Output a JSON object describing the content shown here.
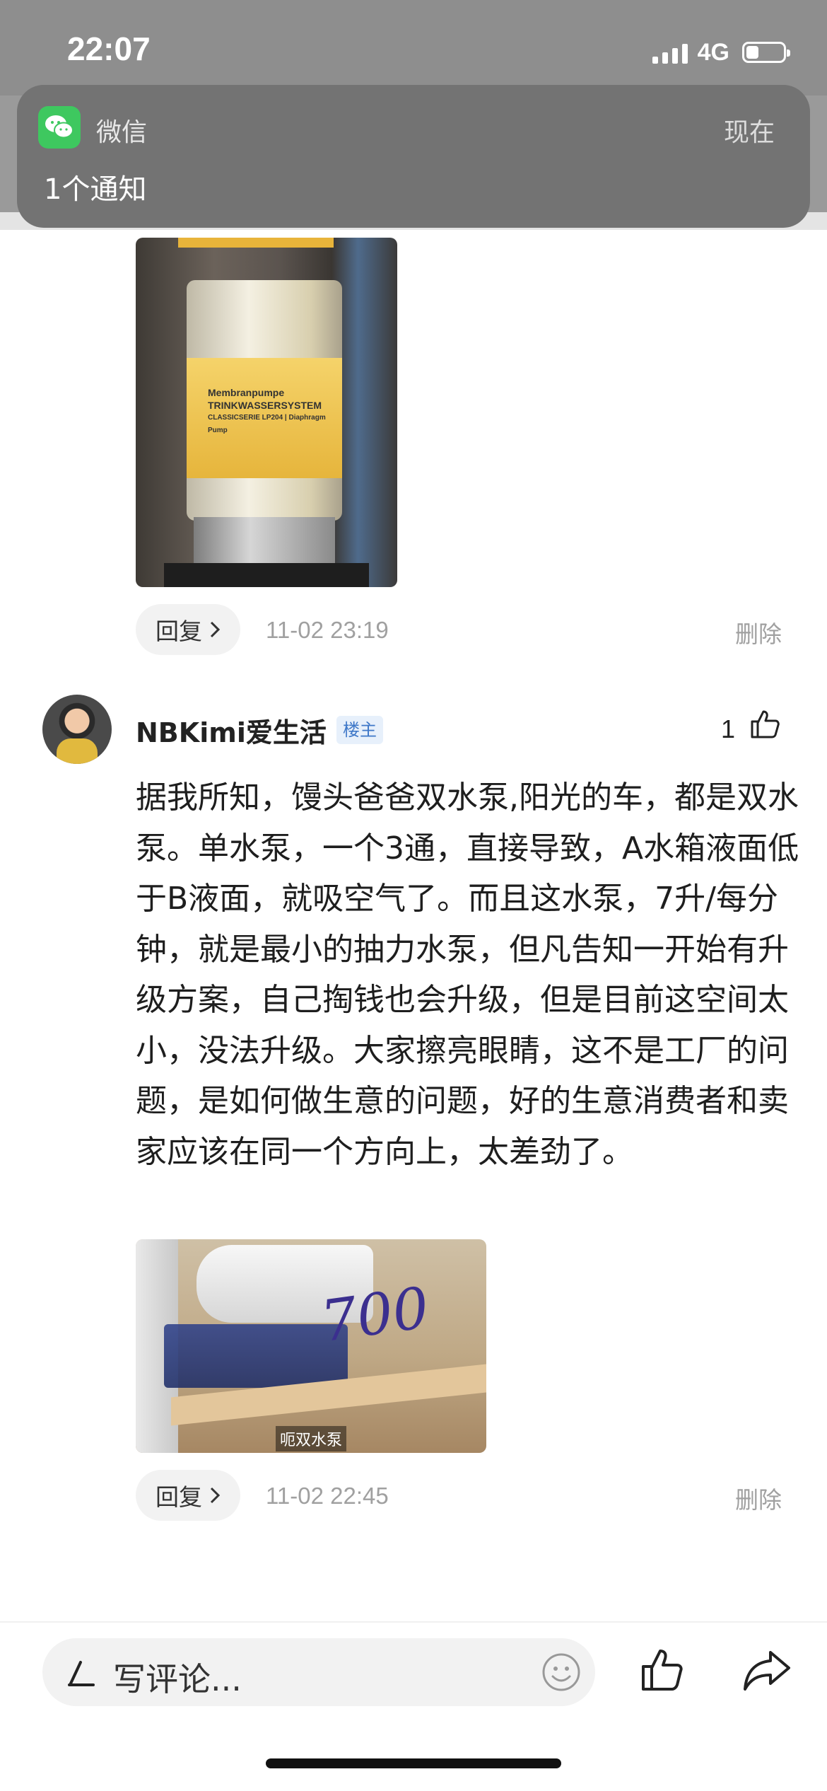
{
  "status_bar": {
    "time": "22:07",
    "network": "4G",
    "battery_level": 0.3
  },
  "notification": {
    "app_name": "微信",
    "time": "现在",
    "body": "1个通知"
  },
  "reply_top": {
    "reply_label": "回复",
    "time": "11-02 23:19",
    "delete_label": "删除"
  },
  "comment": {
    "username": "NBKimi爱生活",
    "badge": "楼主",
    "like_count": "1",
    "text": "据我所知，馒头爸爸双水泵,阳光的车，都是双水泵。单水泵，一个3通，直接导致，A水箱液面低于B液面，就吸空气了。而且这水泵，7升/每分钟，就是最小的抽力水泵，但凡告知一开始有升级方案，自己掏钱也会升级，但是目前这空间太小，没法升级。大家擦亮眼睛，这不是工厂的问题，是如何做生意的问题，好的生意消费者和卖家应该在同一个方向上，太差劲了。",
    "image_caption": "呃双水泵",
    "image_marker": "700",
    "reply_label": "回复",
    "time": "11-02 22:45",
    "delete_label": "删除"
  },
  "pump_image": {
    "lines": [
      "Membranpumpe",
      "TRINKWASSERSYSTEM",
      "CLASSICSERIE LP204 | Diaphragm Pump"
    ]
  },
  "bottom_bar": {
    "input_placeholder": "写评论..."
  },
  "colors": {
    "accent_blue": "#3f78c8",
    "wechat_green": "#3ec85f"
  }
}
